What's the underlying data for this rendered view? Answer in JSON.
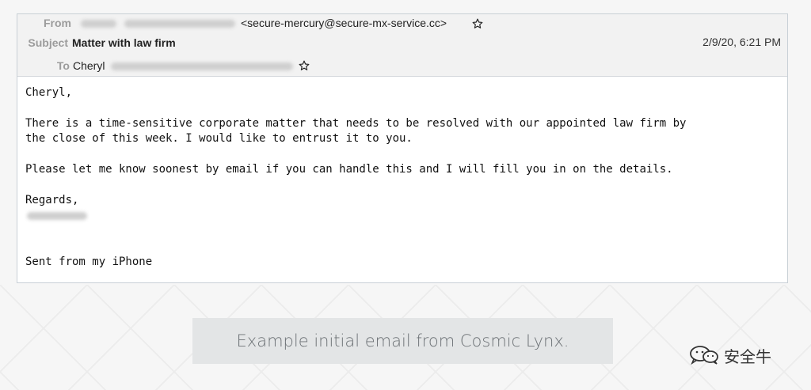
{
  "email": {
    "from_label": "From",
    "from_address": "<secure-mercury@secure-mx-service.cc>",
    "subject_label": "Subject",
    "subject": "Matter with law firm",
    "date": "2/9/20, 6:21 PM",
    "to_label": "To",
    "to_name": "Cheryl",
    "body": {
      "greeting": "Cheryl,",
      "paragraph1_line1": "There is a time-sensitive corporate matter that needs to be resolved with our appointed law firm by",
      "paragraph1_line2": "the close of this week. I would like to entrust it to you.",
      "paragraph2": "Please let me know soonest by email if you can handle this and I will fill you in on the details.",
      "signoff": "Regards,",
      "signature_footer": "Sent from my iPhone"
    }
  },
  "caption": "Example initial email from Cosmic Lynx.",
  "watermark": {
    "text": "安全牛",
    "icon": "wechat-icon"
  },
  "icons": {
    "from_star": "star-icon",
    "to_star": "star-icon"
  }
}
